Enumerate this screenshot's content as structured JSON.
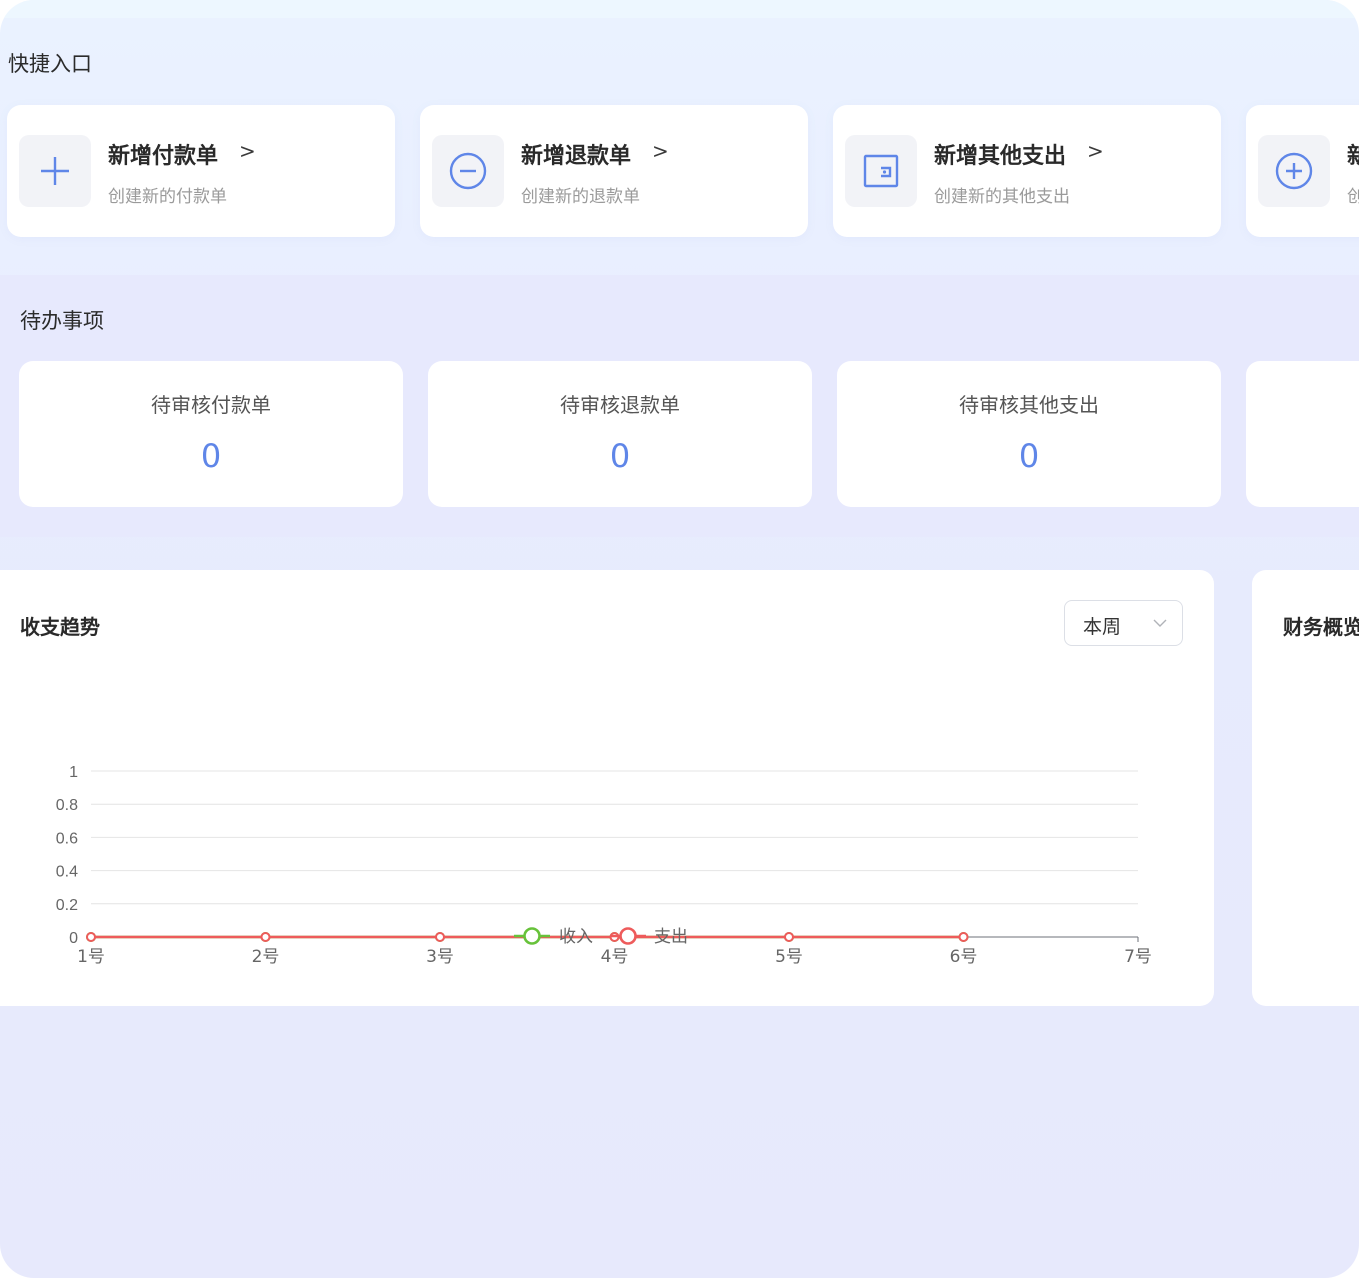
{
  "quick_entry": {
    "title": "快捷入口",
    "cards": [
      {
        "title": "新增付款单",
        "chevron": ">",
        "subtitle": "创建新的付款单",
        "icon": "plus-icon"
      },
      {
        "title": "新增退款单",
        "chevron": ">",
        "subtitle": "创建新的退款单",
        "icon": "minus-circle-icon"
      },
      {
        "title": "新增其他支出",
        "chevron": ">",
        "subtitle": "创建新的其他支出",
        "icon": "wallet-icon"
      },
      {
        "title": "新",
        "subtitle": "创",
        "icon": "plus-circle-icon"
      }
    ]
  },
  "todo": {
    "title": "待办事项",
    "items": [
      {
        "label": "待审核付款单",
        "count": "0"
      },
      {
        "label": "待审核退款单",
        "count": "0"
      },
      {
        "label": "待审核其他支出",
        "count": "0"
      }
    ]
  },
  "trend": {
    "title": "收支趋势",
    "period_select": "本周"
  },
  "finance_overview": {
    "title": "财务概览"
  },
  "colors": {
    "accent": "#5f86e8",
    "income": "#67c23a",
    "expense": "#ee5b5b"
  },
  "chart_data": {
    "type": "line",
    "categories": [
      "1号",
      "2号",
      "3号",
      "4号",
      "5号",
      "6号",
      "7号"
    ],
    "series": [
      {
        "name": "收入",
        "values": [
          0,
          0,
          0,
          0,
          0,
          0,
          null
        ]
      },
      {
        "name": "支出",
        "values": [
          0,
          0,
          0,
          0,
          0,
          0,
          null
        ]
      }
    ],
    "yticks": [
      "0",
      "0.2",
      "0.4",
      "0.6",
      "0.8",
      "1"
    ],
    "ylim": [
      0,
      1
    ],
    "grid": true,
    "legend": "bottom-center"
  }
}
